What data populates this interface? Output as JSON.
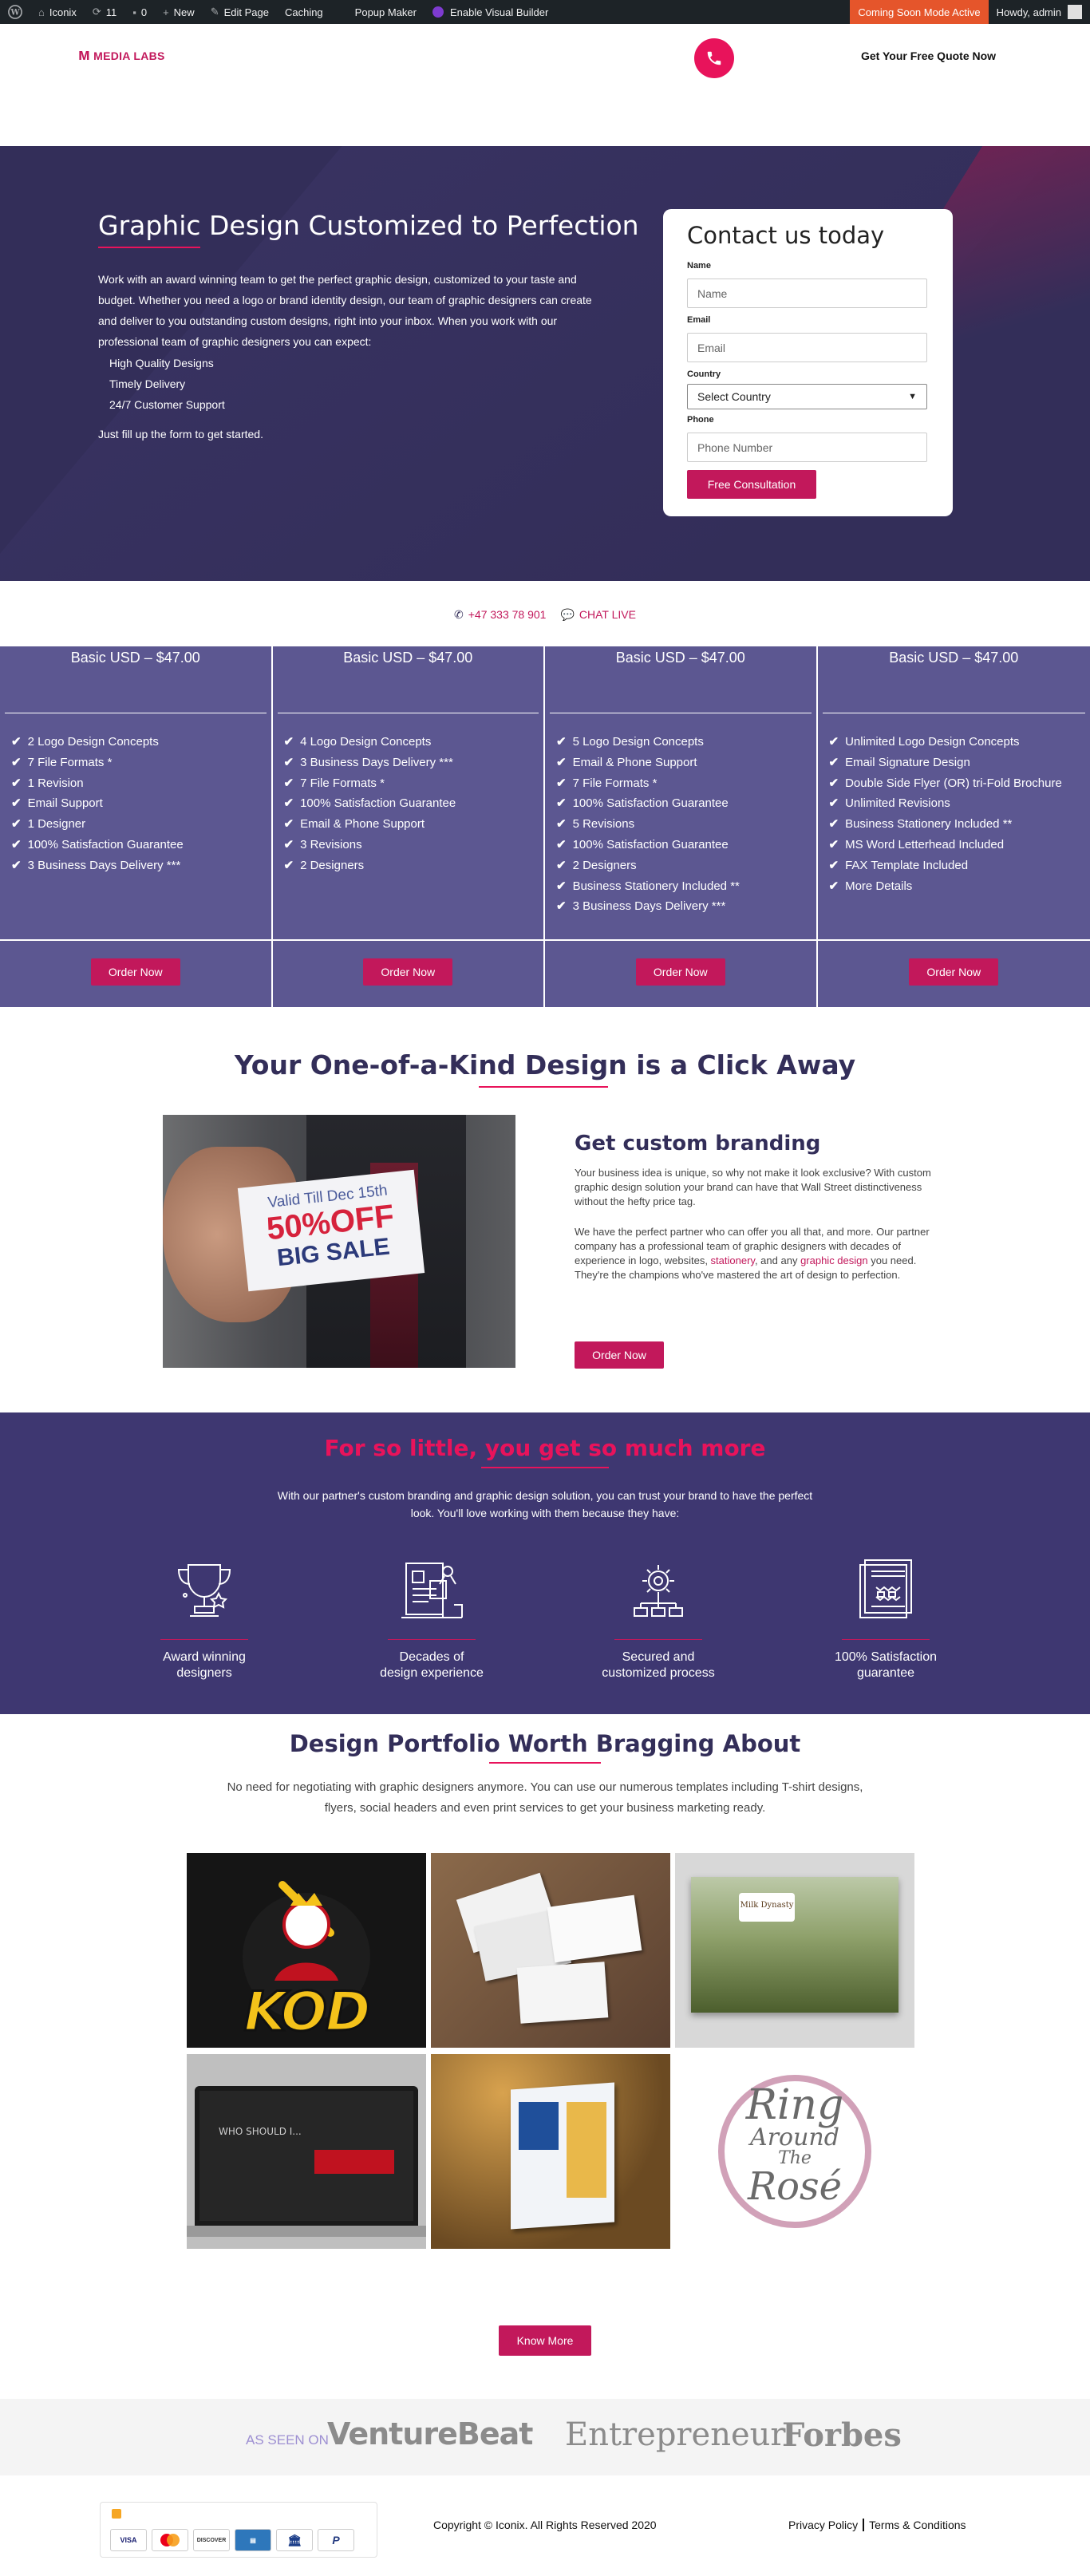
{
  "adminbar": {
    "site_name": "Iconix",
    "updates": "11",
    "comments": "0",
    "new_label": "New",
    "edit_label": "Edit Page",
    "caching_label": "Caching",
    "popup_label": "Popup Maker",
    "builder_label": "Enable Visual Builder",
    "mode_label": "Coming Soon Mode Active",
    "howdy": "Howdy, admin"
  },
  "header": {
    "logo_text": "MEDIA LABS",
    "cta": "Get Your Free Quote Now"
  },
  "hero": {
    "title": "Graphic Design Customized to Perfection",
    "body": "Work with an award winning team to get the perfect graphic design, customized to your taste and budget. Whether you need a logo or brand identity design, our team of graphic designers can create and deliver to you outstanding custom designs, right into your inbox. When you work with our professional team of graphic designers you can expect:",
    "list": [
      "High Quality Designs",
      "Timely Delivery",
      "24/7 Customer Support"
    ],
    "footer": "Just fill up the form to get started."
  },
  "form": {
    "title": "Contact us today",
    "name_label": "Name",
    "name_placeholder": "Name",
    "email_label": "Email",
    "email_placeholder": "Email",
    "country_label": "Country",
    "country_value": "Select Country",
    "phone_label": "Phone",
    "phone_placeholder": "Phone Number",
    "submit": "Free Consultation"
  },
  "contact": {
    "phone": "+47 333 78 901",
    "chat": "CHAT LIVE"
  },
  "pricing": [
    {
      "title": "Basic USD – $47.00",
      "button": "Order Now",
      "features": [
        "2 Logo Design Concepts",
        "7 File Formats *",
        "1 Revision",
        "Email Support",
        "1 Designer",
        "100% Satisfaction Guarantee",
        "3 Business Days Delivery ***"
      ]
    },
    {
      "title": "Basic USD – $47.00",
      "button": "Order Now",
      "features": [
        "4 Logo Design Concepts",
        "3 Business Days Delivery ***",
        "7 File Formats *",
        "100% Satisfaction Guarantee",
        "Email & Phone Support",
        "3 Revisions",
        "2 Designers"
      ]
    },
    {
      "title": "Basic USD – $47.00",
      "button": "Order Now",
      "features": [
        "5 Logo Design Concepts",
        "Email & Phone Support",
        "7 File Formats *",
        "100% Satisfaction Guarantee",
        "5 Revisions",
        "100% Satisfaction Guarantee",
        "2 Designers",
        "Business Stationery Included **",
        "3 Business Days Delivery ***"
      ]
    },
    {
      "title": "Basic USD – $47.00",
      "button": "Order Now",
      "features": [
        "Unlimited Logo Design Concepts",
        "Email Signature Design",
        "Double Side Flyer (OR) tri-Fold Brochure",
        "Unlimited Revisions",
        "Business Stationery Included **",
        "MS Word Letterhead Included",
        "FAX Template Included",
        "More Details"
      ]
    }
  ],
  "kind": {
    "title": "Your One-of-a-Kind Design is a Click Away",
    "card_line1": "Valid Till Dec 15th",
    "card_line2": "50%OFF",
    "card_line3": "BIG SALE",
    "brand_title": "Get custom branding",
    "p1": "Your business idea is unique, so why not make it look exclusive? With custom graphic design solution your brand can have that Wall Street distinctiveness without the hefty price tag.",
    "p2_a": "We have the perfect partner who can offer you all that, and more. Our partner company has a professional team of graphic designers with decades of experience in logo, websites, ",
    "p2_link1": "stationery",
    "p2_b": ", and any ",
    "p2_link2": "graphic design",
    "p2_c": " you need. They're the champions who've mastered the art of design to perfection.",
    "button": "Order Now"
  },
  "more": {
    "title": "For so little, you get so much more",
    "body": "With our partner's custom branding and graphic design solution, you can trust your brand to have the perfect look. You'll love working with them because they have:",
    "features": [
      {
        "line1": "Award winning",
        "line2": "designers",
        "icon": "trophy-icon"
      },
      {
        "line1": "Decades of",
        "line2": "design experience",
        "icon": "designer-desk-icon"
      },
      {
        "line1": "Secured and",
        "line2": "customized process",
        "icon": "gear-network-icon"
      },
      {
        "line1": "100% Satisfaction",
        "line2": "guarantee",
        "icon": "certificate-icon"
      }
    ]
  },
  "portfolio": {
    "title": "Design Portfolio Worth Bragging About",
    "body": "No need for negotiating with graphic designers anymore. You can use our numerous templates including T-shirt designs, flyers, social headers and even print services to get your business marketing ready.",
    "kod_text": "KOD",
    "milk_text": "Milk Dynasty",
    "laptop_heading": "WHO SHOULD I...",
    "ring_line1": "Ring",
    "ring_line2": "Around",
    "ring_line3": "The",
    "ring_line4": "Rosé",
    "button": "Know More"
  },
  "seen": {
    "label": "AS SEEN ON",
    "logos": [
      "VentureBeat",
      "Entrepreneur",
      "Forbes"
    ]
  },
  "footer": {
    "cards": [
      "VISA",
      "MC",
      "DISCOVER",
      "AMEX",
      "BANK",
      "P"
    ],
    "copyright": "Copyright © Iconix. All Rights Reserved 2020",
    "privacy": "Privacy Policy",
    "terms": "Terms & Conditions"
  },
  "colors": {
    "accent": "#c2185b",
    "hero_bg": "#332e59",
    "pricing_bg": "#5c5791",
    "features_bg": "#3e3771"
  }
}
